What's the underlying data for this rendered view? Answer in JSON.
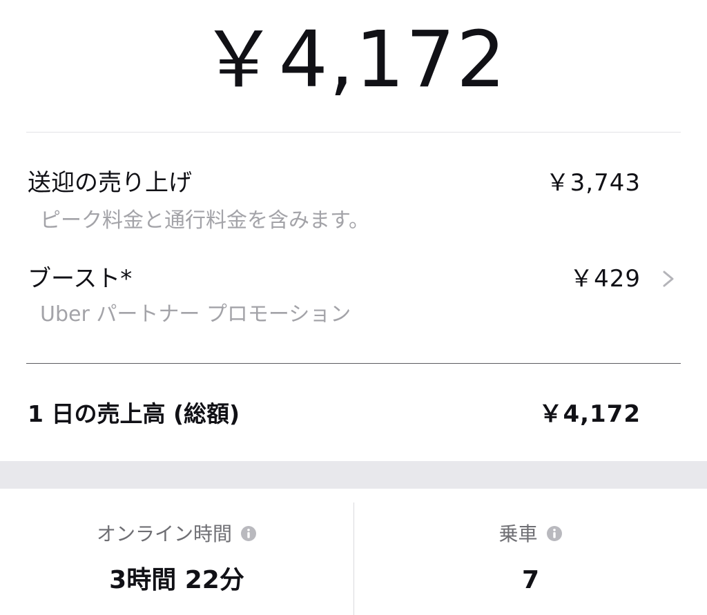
{
  "summary": {
    "total_amount": "￥4,172"
  },
  "breakdown": {
    "fares": {
      "label": "送迎の売り上げ",
      "sublabel": "ピーク料金と通行料金を含みます。",
      "amount": "￥3,743"
    },
    "boost": {
      "label": "ブースト*",
      "sublabel": "Uber パートナー プロモーション",
      "amount": "￥429",
      "chevron_icon": "chevron-right"
    },
    "daily_total": {
      "label": "1 日の売上高 (総額)",
      "amount": "￥4,172"
    }
  },
  "stats": {
    "online_time": {
      "label": "オンライン時間",
      "value": "3時間 22分",
      "info_icon": "info-circle"
    },
    "trips": {
      "label": "乗車",
      "value": "7",
      "info_icon": "info-circle"
    }
  },
  "colors": {
    "text_primary": "#111116",
    "text_secondary": "#a3a3a8",
    "divider": "#e2e2e6",
    "band": "#e8e8ec"
  }
}
